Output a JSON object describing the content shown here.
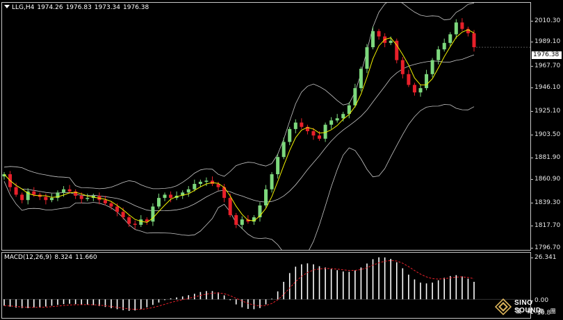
{
  "header": {
    "symbol": "LLG,H4",
    "open": "1974.26",
    "high": "1976.83",
    "low": "1973.34",
    "close": "1976.38"
  },
  "price_axis": {
    "ticks": [
      "2010.30",
      "1989.10",
      "1967.70",
      "1946.10",
      "1925.10",
      "1903.50",
      "1881.90",
      "1860.90",
      "1839.30",
      "1817.70",
      "1796.70"
    ],
    "current": "1976.38"
  },
  "macd": {
    "label": "MACD(12,26,9)",
    "value": "8.324",
    "signal": "11.660",
    "axis_ticks": [
      "26.341",
      "0.00",
      "-10.8"
    ]
  },
  "logo": {
    "name": "SINO SOUND",
    "sub": "漢 聲 集 團"
  },
  "colors": {
    "background": "#000000",
    "bull": "#7dd87d",
    "bear": "#e8202a",
    "ma": "#f2f200",
    "bands": "#c8c8c8",
    "signal": "#e8202a",
    "histogram": "#ffffff"
  },
  "chart_data": [
    {
      "type": "line",
      "title": "",
      "xlabel": "",
      "ylabel": "",
      "ylim": [
        1793,
        2020
      ],
      "series": [
        {
          "values": [
            1862,
            1850,
            1843,
            1838,
            1846,
            1843,
            1841,
            1838,
            1840,
            1845,
            1848,
            1846,
            1842,
            1839,
            1840,
            1842,
            1838,
            1835,
            1832,
            1827,
            1822,
            1816,
            1815,
            1820,
            1818,
            1832,
            1840,
            1843,
            1840,
            1842,
            1845,
            1848,
            1853,
            1855,
            1856,
            1853,
            1850,
            1840,
            1824,
            1815,
            1820,
            1818,
            1822,
            1833,
            1848,
            1862,
            1878,
            1892,
            1904,
            1910,
            1906,
            1902,
            1898,
            1895,
            1908,
            1912,
            1914,
            1918,
            1926,
            1942,
            1960,
            1980,
            1995,
            1990,
            1984,
            1986,
            1968,
            1955,
            1945,
            1938,
            1942,
            1955,
            1968,
            1978,
            1984,
            1992,
            2003,
            1997,
            1993,
            1980
          ]
        }
      ]
    },
    {
      "type": "bar",
      "title": "",
      "xlabel": "",
      "ylabel": "",
      "ylim": [
        -10.8,
        28
      ],
      "series": [
        {
          "values": [
            -4,
            -4.6,
            -5.2,
            -5.5,
            -5.5,
            -5.2,
            -4.9,
            -4.5,
            -4,
            -3.5,
            -3,
            -2.8,
            -3,
            -3.2,
            -3.3,
            -3.6,
            -4.2,
            -4.8,
            -5.6,
            -6.2,
            -6.8,
            -7.2,
            -7,
            -6.2,
            -5,
            -3.5,
            -2,
            -0.5,
            0.6,
            1.2,
            1.8,
            2.6,
            3.5,
            4.6,
            5.2,
            5.2,
            4.4,
            2.5,
            -0.5,
            -3.2,
            -5,
            -6,
            -6.2,
            -5.5,
            -3.2,
            0.4,
            5,
            11,
            16.5,
            20.5,
            22,
            22.6,
            22,
            20.8,
            20,
            19,
            18.3,
            17.5,
            17.3,
            18.2,
            20,
            22.5,
            25.2,
            26.4,
            26.3,
            25.4,
            23.3,
            19.5,
            15.5,
            12.5,
            10.5,
            10,
            10.5,
            12,
            13.5,
            14.6,
            15.2,
            14.4,
            13,
            11
          ]
        }
      ]
    }
  ]
}
